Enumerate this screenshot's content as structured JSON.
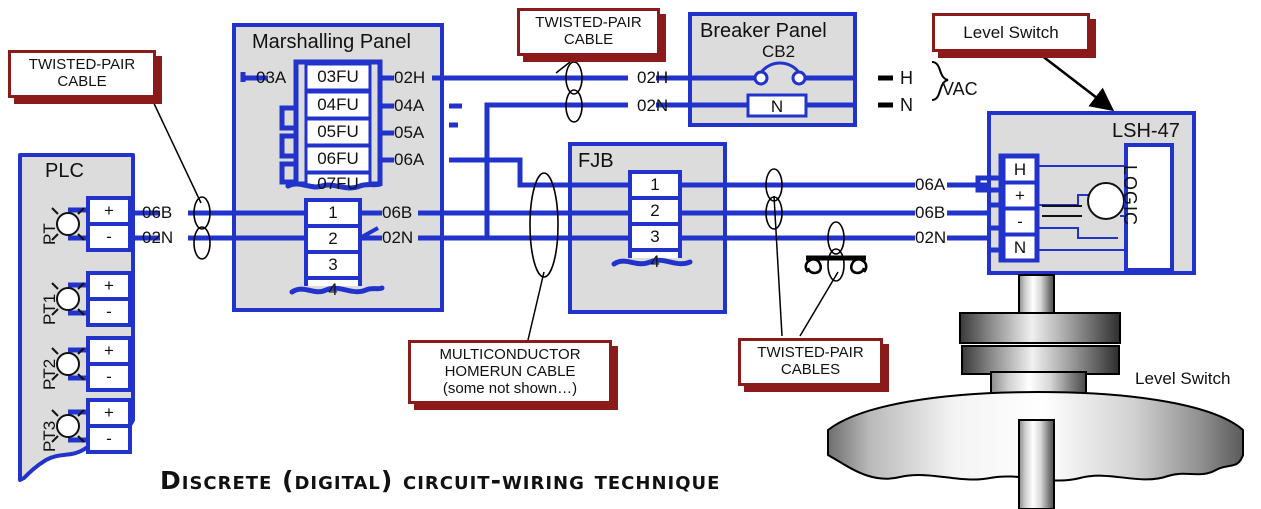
{
  "diagram": {
    "title": "Discrete (digital) circuit-wiring technique",
    "colors": {
      "wire_blue": "#2233CC",
      "panel_fill": "#DCDCDC",
      "panel_border": "#2233CC",
      "callout_border": "#8B1A1A",
      "callout_fill": "#FFFFFF",
      "text": "#111111"
    }
  },
  "callouts": [
    {
      "id": "twisted-pair-cable-left",
      "lines": [
        "TWISTED-PAIR",
        "CABLE"
      ]
    },
    {
      "id": "twisted-pair-cable-top",
      "lines": [
        "TWISTED-PAIR",
        "CABLE"
      ]
    },
    {
      "id": "level-switch-top",
      "lines": [
        "Level Switch"
      ]
    },
    {
      "id": "multiconductor-homerun",
      "lines": [
        "MULTICONDUCTOR",
        "HOMERUN CABLE",
        "(some not shown…)"
      ]
    },
    {
      "id": "twisted-pair-cables",
      "lines": [
        "TWISTED-PAIR",
        "CABLES"
      ]
    }
  ],
  "plc": {
    "title": "PLC",
    "channels": [
      {
        "name": "PT",
        "plus": "+",
        "minus": "-"
      },
      {
        "name": "PT1",
        "plus": "+",
        "minus": "-"
      },
      {
        "name": "PT2",
        "plus": "+",
        "minus": "-"
      },
      {
        "name": "PT3",
        "plus": "+",
        "minus": "-"
      }
    ],
    "wire_labels": [
      "06B",
      "02N"
    ]
  },
  "marshalling_panel": {
    "title": "Marshalling Panel",
    "left_tag": "03A",
    "fuses": [
      "03FU",
      "04FU",
      "05FU",
      "06FU",
      "07FU"
    ],
    "fuse_out_labels": [
      "02H",
      "04A",
      "05A",
      "06A"
    ],
    "terminals": [
      "1",
      "2",
      "3",
      "4"
    ],
    "terminal_out_labels": [
      "06B",
      "02N"
    ]
  },
  "fjb": {
    "title": "FJB",
    "terminals": [
      "1",
      "2",
      "3",
      "4"
    ]
  },
  "breaker_panel": {
    "title": "Breaker Panel",
    "breaker": "CB2",
    "neutral_block": "N",
    "bus_labels": [
      "H",
      "N"
    ],
    "supply_label": "VAC"
  },
  "level_switch_device": {
    "tag": "LSH-47",
    "terminals": [
      "H",
      "+",
      "-",
      "N"
    ],
    "block": "LOGIC",
    "caption": "Level Switch"
  },
  "field_wire_labels": [
    "06A",
    "06B",
    "02N"
  ],
  "marshalling_right_labels": [
    "02H",
    "02N"
  ]
}
